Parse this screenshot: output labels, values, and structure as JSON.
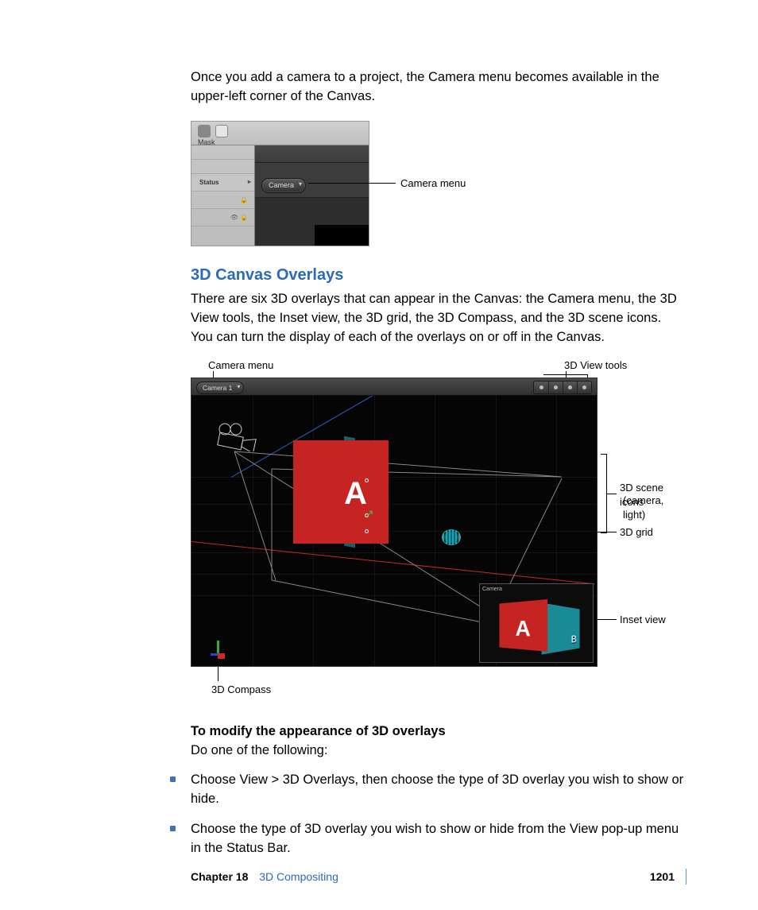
{
  "intro": "Once you add a camera to a project, the Camera menu becomes available in the upper-left corner of the Canvas.",
  "fig1": {
    "mask": "Mask",
    "status": "Status",
    "cameraBtn": "Camera",
    "callout": "Camera menu"
  },
  "section": {
    "heading": "3D Canvas Overlays",
    "body": "There are six 3D overlays that can appear in the Canvas: the Camera menu, the 3D View tools, the Inset view, the 3D grid, the 3D Compass, and the 3D scene icons. You can turn the display of each of the overlays on or off in the Canvas."
  },
  "fig2": {
    "camera1": "Camera 1",
    "insetLabel": "Camera",
    "letterA": "A",
    "letterB": "B",
    "callouts": {
      "cameraMenu": "Camera menu",
      "viewTools": "3D View tools",
      "sceneIcons1": "3D scene icons",
      "sceneIcons2": "(camera, light)",
      "grid": "3D grid",
      "insetView": "Inset view",
      "compass": "3D Compass"
    }
  },
  "modify": {
    "heading": "To modify the appearance of 3D overlays",
    "lead": "Do one of the following:",
    "items": [
      "Choose View > 3D Overlays, then choose the type of 3D overlay you wish to show or hide.",
      "Choose the type of 3D overlay you wish to show or hide from the View pop-up menu in the Status Bar."
    ]
  },
  "footer": {
    "chapter": "Chapter 18",
    "title": "3D Compositing",
    "page": "1201"
  }
}
